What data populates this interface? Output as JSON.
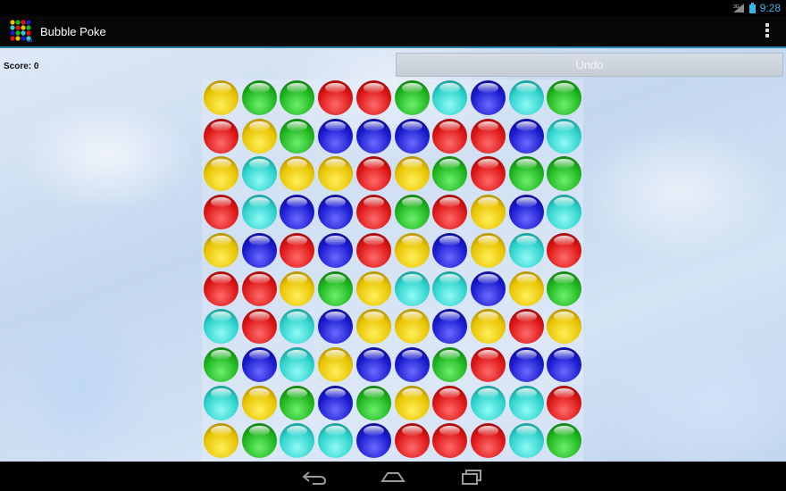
{
  "status_bar": {
    "time": "9:28",
    "signal_label": "3G",
    "icons": [
      "signal-icon",
      "battery-icon"
    ]
  },
  "action_bar": {
    "app_title": "Bubble Poke",
    "app_icon": "bubble-grid-icon",
    "overflow_icon": "overflow-menu-icon"
  },
  "game": {
    "score_text": "Score: 0",
    "undo_label": "Undo",
    "colors": {
      "yellow": "#e8c400",
      "green": "#1fb51f",
      "red": "#dd1515",
      "blue": "#1a1ad0",
      "cyan": "#2ed2cc"
    },
    "grid": [
      [
        "yellow",
        "green",
        "green",
        "red",
        "red",
        "green",
        "cyan",
        "blue",
        "cyan",
        "green"
      ],
      [
        "red",
        "yellow",
        "green",
        "blue",
        "blue",
        "blue",
        "red",
        "red",
        "blue",
        "cyan"
      ],
      [
        "yellow",
        "cyan",
        "yellow",
        "yellow",
        "red",
        "yellow",
        "green",
        "red",
        "green",
        "green"
      ],
      [
        "red",
        "cyan",
        "blue",
        "blue",
        "red",
        "green",
        "red",
        "yellow",
        "blue",
        "cyan"
      ],
      [
        "yellow",
        "blue",
        "red",
        "blue",
        "red",
        "yellow",
        "blue",
        "yellow",
        "cyan",
        "red"
      ],
      [
        "red",
        "red",
        "yellow",
        "green",
        "yellow",
        "cyan",
        "cyan",
        "blue",
        "yellow",
        "green"
      ],
      [
        "cyan",
        "red",
        "cyan",
        "blue",
        "yellow",
        "yellow",
        "blue",
        "yellow",
        "red",
        "yellow"
      ],
      [
        "green",
        "blue",
        "cyan",
        "yellow",
        "blue",
        "blue",
        "green",
        "red",
        "blue",
        "blue"
      ],
      [
        "cyan",
        "yellow",
        "green",
        "blue",
        "green",
        "yellow",
        "red",
        "cyan",
        "cyan",
        "red"
      ],
      [
        "yellow",
        "green",
        "cyan",
        "cyan",
        "blue",
        "red",
        "red",
        "red",
        "cyan",
        "green"
      ]
    ]
  },
  "nav_bar": {
    "buttons": [
      "back-icon",
      "home-icon",
      "recent-apps-icon"
    ]
  }
}
